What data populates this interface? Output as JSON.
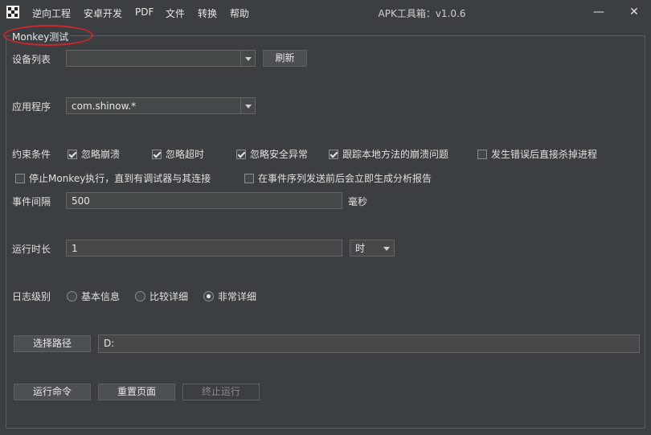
{
  "window": {
    "title": "APK工具箱：v1.0.6",
    "minimize": "—",
    "maximize": "☐",
    "close": "✕"
  },
  "menu": [
    "逆向工程",
    "安卓开发",
    "PDF",
    "文件",
    "转换",
    "帮助"
  ],
  "group_title": "Monkey测试",
  "device": {
    "label": "设备列表",
    "value": "",
    "refresh": "刷新"
  },
  "app": {
    "label": "应用程序",
    "value": "com.shinow.*"
  },
  "constraints": {
    "label": "约束条件",
    "options": [
      {
        "label": "忽略崩溃",
        "checked": true
      },
      {
        "label": "忽略超时",
        "checked": true
      },
      {
        "label": "忽略安全异常",
        "checked": true
      },
      {
        "label": "跟踪本地方法的崩溃问题",
        "checked": true
      },
      {
        "label": "发生错误后直接杀掉进程",
        "checked": false
      },
      {
        "label": "停止Monkey执行，直到有调试器与其连接",
        "checked": false
      },
      {
        "label": "在事件序列发送前后会立即生成分析报告",
        "checked": false
      }
    ]
  },
  "interval": {
    "label": "事件间隔",
    "value": "500",
    "unit": "毫秒"
  },
  "duration": {
    "label": "运行时长",
    "value": "1",
    "unit": "时"
  },
  "log_level": {
    "label": "日志级别",
    "options": [
      {
        "label": "基本信息",
        "selected": false
      },
      {
        "label": "比较详细",
        "selected": false
      },
      {
        "label": "非常详细",
        "selected": true
      }
    ]
  },
  "path": {
    "button": "选择路径",
    "value": "D:"
  },
  "actions": {
    "run": "运行命令",
    "reset": "重置页面",
    "stop": "终止运行"
  },
  "colors": {
    "background": "#3c3f41",
    "annotation": "#d0262b"
  }
}
